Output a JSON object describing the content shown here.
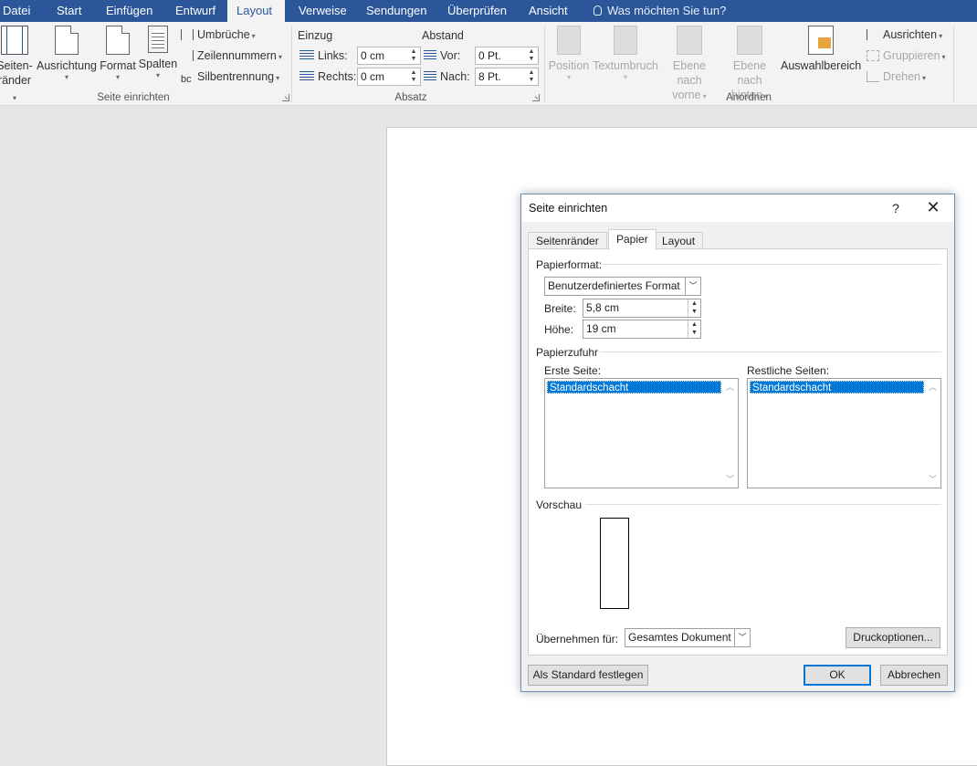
{
  "ribbon_tabs": [
    "Datei",
    "Start",
    "Einfügen",
    "Entwurf",
    "Layout",
    "Verweise",
    "Sendungen",
    "Überprüfen",
    "Ansicht"
  ],
  "tell_me": "Was möchten Sie tun?",
  "seite_einrichten_group": {
    "label": "Seite einrichten",
    "margins": "Seiten-",
    "margins_line2": "ränder",
    "orientation": "Ausrichtung",
    "size": "Format",
    "columns": "Spalten",
    "breaks": "Umbrüche",
    "line_numbers": "Zeilennummern",
    "hyphenation": "Silbentrennung"
  },
  "absatz_group": {
    "label": "Absatz",
    "indent_title": "Einzug",
    "spacing_title": "Abstand",
    "left_label": "Links:",
    "left_value": "0  cm",
    "right_label": "Rechts:",
    "right_value": "0  cm",
    "before_label": "Vor:",
    "before_value": "0 Pt.",
    "after_label": "Nach:",
    "after_value": "8 Pt."
  },
  "anordnen_group": {
    "label": "Anordnen",
    "position": "Position",
    "wrap_text": "Textumbruch",
    "bring_forward_1": "Ebene nach",
    "bring_forward_2": "vorne",
    "send_backward_1": "Ebene nach",
    "send_backward_2": "hinten",
    "selection_pane": "Auswahlbereich",
    "align": "Ausrichten",
    "group": "Gruppieren",
    "rotate": "Drehen"
  },
  "dialog": {
    "title": "Seite einrichten",
    "help": "?",
    "tabs": [
      "Seitenränder",
      "Papier",
      "Layout"
    ],
    "paper_size_section": "Papierformat:",
    "paper_size_value": "Benutzerdefiniertes Format",
    "width_label": "Breite:",
    "width_value": "5,8 cm",
    "height_label": "Höhe:",
    "height_value": "19 cm",
    "paper_source_section": "Papierzufuhr",
    "first_page_label": "Erste Seite:",
    "first_page_item": "Standardschacht",
    "other_pages_label": "Restliche Seiten:",
    "other_pages_item": "Standardschacht",
    "preview_section": "Vorschau",
    "apply_to_label": "Übernehmen für:",
    "apply_to_value": "Gesamtes Dokument",
    "print_options_button": "Druckoptionen...",
    "set_default_button": "Als Standard festlegen",
    "ok_button": "OK",
    "cancel_button": "Abbrechen"
  },
  "colors": {
    "ribbon_blue": "#2b579a",
    "selection_blue": "#0078d7"
  }
}
